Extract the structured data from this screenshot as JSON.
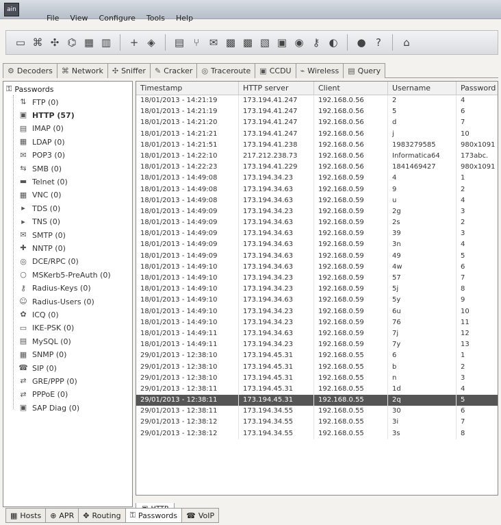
{
  "window": {
    "app_icon_text": "ain"
  },
  "menu": [
    "File",
    "View",
    "Configure",
    "Tools",
    "Help"
  ],
  "toolbar_icons": [
    "open-icon",
    "network-icon",
    "sniffer-icon",
    "tree-icon",
    "grid-icon",
    "barcode-icon",
    "plus-icon",
    "shield-icon",
    "clipboard-icon",
    "route-icon",
    "message-icon",
    "hash1-icon",
    "hash2-icon",
    "hash3-icon",
    "cert-icon",
    "db-icon",
    "key-icon",
    "lock-icon",
    "info-icon",
    "help-icon",
    "bookmark-icon"
  ],
  "top_tabs": [
    {
      "label": "Decoders",
      "icon": "decoders-icon"
    },
    {
      "label": "Network",
      "icon": "network-icon"
    },
    {
      "label": "Sniffer",
      "icon": "sniffer-icon"
    },
    {
      "label": "Cracker",
      "icon": "cracker-icon"
    },
    {
      "label": "Traceroute",
      "icon": "traceroute-icon"
    },
    {
      "label": "CCDU",
      "icon": "ccdu-icon"
    },
    {
      "label": "Wireless",
      "icon": "wireless-icon"
    },
    {
      "label": "Query",
      "icon": "query-icon"
    }
  ],
  "tree": {
    "root": "Passwords",
    "items": [
      {
        "label": "FTP (0)",
        "icon": "ftp-icon"
      },
      {
        "label": "HTTP (57)",
        "icon": "http-icon",
        "selected": true
      },
      {
        "label": "IMAP (0)",
        "icon": "imap-icon"
      },
      {
        "label": "LDAP (0)",
        "icon": "ldap-icon"
      },
      {
        "label": "POP3 (0)",
        "icon": "pop3-icon"
      },
      {
        "label": "SMB (0)",
        "icon": "smb-icon"
      },
      {
        "label": "Telnet (0)",
        "icon": "telnet-icon"
      },
      {
        "label": "VNC (0)",
        "icon": "vnc-icon"
      },
      {
        "label": "TDS (0)",
        "icon": "tds-icon"
      },
      {
        "label": "TNS (0)",
        "icon": "tns-icon"
      },
      {
        "label": "SMTP (0)",
        "icon": "smtp-icon"
      },
      {
        "label": "NNTP (0)",
        "icon": "nntp-icon"
      },
      {
        "label": "DCE/RPC (0)",
        "icon": "dcerpc-icon"
      },
      {
        "label": "MSKerb5-PreAuth (0)",
        "icon": "kerberos-icon"
      },
      {
        "label": "Radius-Keys (0)",
        "icon": "radius-keys-icon"
      },
      {
        "label": "Radius-Users (0)",
        "icon": "radius-users-icon"
      },
      {
        "label": "ICQ (0)",
        "icon": "icq-icon"
      },
      {
        "label": "IKE-PSK (0)",
        "icon": "ike-icon"
      },
      {
        "label": "MySQL (0)",
        "icon": "mysql-icon"
      },
      {
        "label": "SNMP (0)",
        "icon": "snmp-icon"
      },
      {
        "label": "SIP (0)",
        "icon": "sip-icon"
      },
      {
        "label": "GRE/PPP (0)",
        "icon": "gre-icon"
      },
      {
        "label": "PPPoE (0)",
        "icon": "pppoe-icon"
      },
      {
        "label": "SAP Diag (0)",
        "icon": "sap-icon"
      }
    ]
  },
  "table": {
    "columns": [
      "Timestamp",
      "HTTP server",
      "Client",
      "Username",
      "Password"
    ],
    "rows": [
      [
        "18/01/2013 - 14:21:19",
        "173.194.41.247",
        "192.168.0.56",
        "2",
        "4"
      ],
      [
        "18/01/2013 - 14:21:19",
        "173.194.41.247",
        "192.168.0.56",
        "5",
        "6"
      ],
      [
        "18/01/2013 - 14:21:20",
        "173.194.41.247",
        "192.168.0.56",
        "d",
        "7"
      ],
      [
        "18/01/2013 - 14:21:21",
        "173.194.41.247",
        "192.168.0.56",
        "j",
        "10"
      ],
      [
        "18/01/2013 - 14:21:51",
        "173.194.41.238",
        "192.168.0.56",
        "1983279585",
        "980x1091"
      ],
      [
        "18/01/2013 - 14:22:10",
        "217.212.238.73",
        "192.168.0.56",
        "Informatica64",
        "173abc."
      ],
      [
        "18/01/2013 - 14:22:23",
        "173.194.41.229",
        "192.168.0.56",
        "1841469427",
        "980x1091"
      ],
      [
        "18/01/2013 - 14:49:08",
        "173.194.34.23",
        "192.168.0.59",
        "4",
        "1"
      ],
      [
        "18/01/2013 - 14:49:08",
        "173.194.34.63",
        "192.168.0.59",
        "9",
        "2"
      ],
      [
        "18/01/2013 - 14:49:08",
        "173.194.34.63",
        "192.168.0.59",
        "u",
        "4"
      ],
      [
        "18/01/2013 - 14:49:09",
        "173.194.34.23",
        "192.168.0.59",
        "2g",
        "3"
      ],
      [
        "18/01/2013 - 14:49:09",
        "173.194.34.63",
        "192.168.0.59",
        "2s",
        "2"
      ],
      [
        "18/01/2013 - 14:49:09",
        "173.194.34.63",
        "192.168.0.59",
        "39",
        "3"
      ],
      [
        "18/01/2013 - 14:49:09",
        "173.194.34.63",
        "192.168.0.59",
        "3n",
        "4"
      ],
      [
        "18/01/2013 - 14:49:09",
        "173.194.34.63",
        "192.168.0.59",
        "49",
        "5"
      ],
      [
        "18/01/2013 - 14:49:10",
        "173.194.34.63",
        "192.168.0.59",
        "4w",
        "6"
      ],
      [
        "18/01/2013 - 14:49:10",
        "173.194.34.23",
        "192.168.0.59",
        "57",
        "7"
      ],
      [
        "18/01/2013 - 14:49:10",
        "173.194.34.23",
        "192.168.0.59",
        "5j",
        "8"
      ],
      [
        "18/01/2013 - 14:49:10",
        "173.194.34.63",
        "192.168.0.59",
        "5y",
        "9"
      ],
      [
        "18/01/2013 - 14:49:10",
        "173.194.34.23",
        "192.168.0.59",
        "6u",
        "10"
      ],
      [
        "18/01/2013 - 14:49:10",
        "173.194.34.23",
        "192.168.0.59",
        "76",
        "11"
      ],
      [
        "18/01/2013 - 14:49:11",
        "173.194.34.63",
        "192.168.0.59",
        "7j",
        "12"
      ],
      [
        "18/01/2013 - 14:49:11",
        "173.194.34.23",
        "192.168.0.59",
        "7y",
        "13"
      ],
      [
        "29/01/2013 - 12:38:10",
        "173.194.45.31",
        "192.168.0.55",
        "6",
        "1"
      ],
      [
        "29/01/2013 - 12:38:10",
        "173.194.45.31",
        "192.168.0.55",
        "b",
        "2"
      ],
      [
        "29/01/2013 - 12:38:10",
        "173.194.45.31",
        "192.168.0.55",
        "n",
        "3"
      ],
      [
        "29/01/2013 - 12:38:11",
        "173.194.45.31",
        "192.168.0.55",
        "1d",
        "4"
      ],
      [
        "29/01/2013 - 12:38:11",
        "173.194.45.31",
        "192.168.0.55",
        "2q",
        "5"
      ],
      [
        "29/01/2013 - 12:38:11",
        "173.194.34.55",
        "192.168.0.55",
        "30",
        "6"
      ],
      [
        "29/01/2013 - 12:38:12",
        "173.194.34.55",
        "192.168.0.55",
        "3i",
        "7"
      ],
      [
        "29/01/2013 - 12:38:12",
        "173.194.34.55",
        "192.168.0.55",
        "3s",
        "8"
      ]
    ],
    "selected_row": 27
  },
  "bottom_tab_label": "HTTP",
  "bottom_tabs": [
    {
      "label": "Hosts",
      "icon": "hosts-icon"
    },
    {
      "label": "APR",
      "icon": "apr-icon"
    },
    {
      "label": "Routing",
      "icon": "routing-icon"
    },
    {
      "label": "Passwords",
      "icon": "passwords-icon",
      "active": true
    },
    {
      "label": "VoIP",
      "icon": "voip-icon"
    }
  ]
}
